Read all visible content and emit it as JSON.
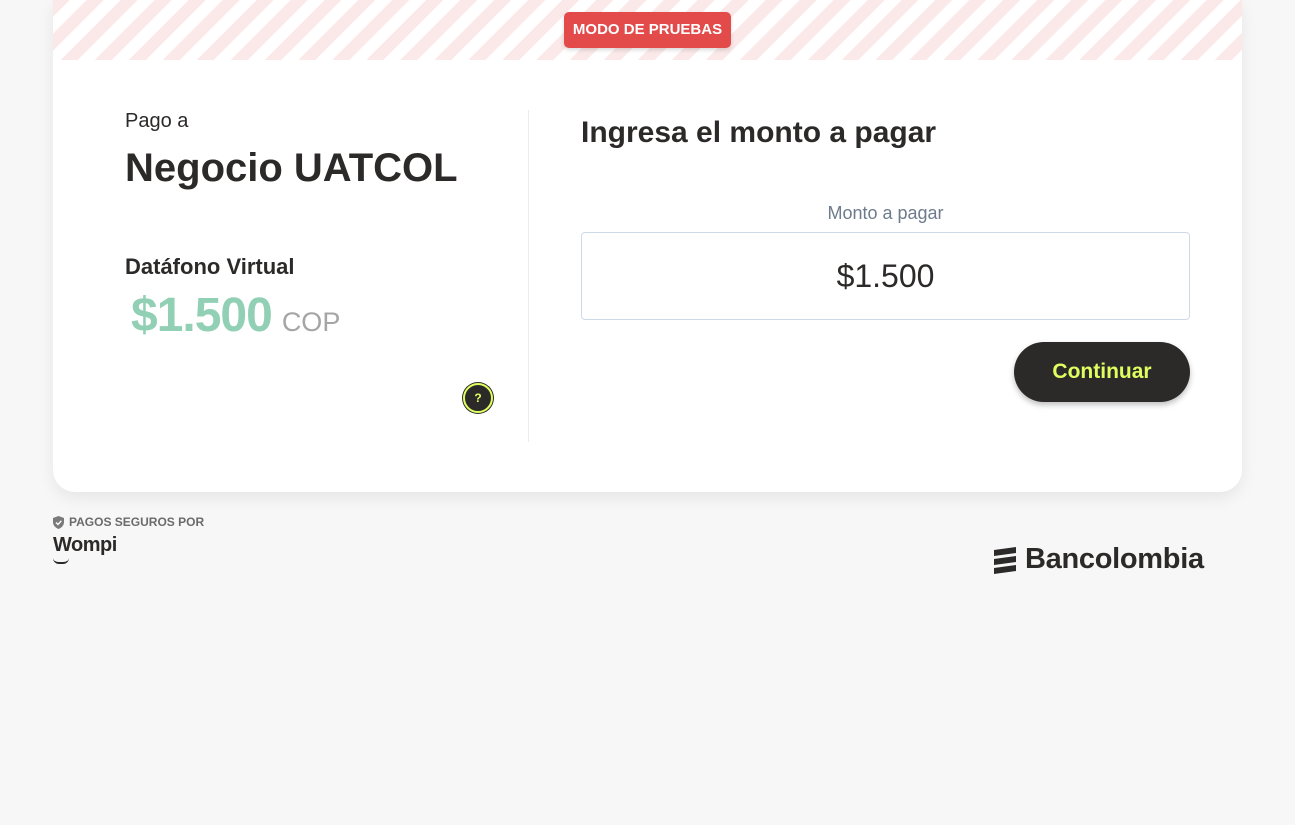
{
  "banner": {
    "test_mode_label": "MODO DE PRUEBAS"
  },
  "merchant": {
    "pay_to_label": "Pago a",
    "name": "Negocio UATCOL",
    "product_name": "Datáfono Virtual",
    "amount": "$1.500",
    "currency": "COP",
    "help_label": "?"
  },
  "payment_form": {
    "title": "Ingresa el monto a pagar",
    "field_label": "Monto a pagar",
    "amount_value": "$1.500",
    "continue_label": "Continuar"
  },
  "footer": {
    "secure_label": "PAGOS SEGUROS POR",
    "wompi_logo_text": "Wompi",
    "bancolombia_logo_text": "Bancolombia"
  },
  "icons": {
    "shield": "shield-check-icon",
    "help": "question-circle-icon",
    "bancolombia": "bancolombia-stripes-icon"
  },
  "colors": {
    "accent_lime": "#dfff61",
    "dark": "#2c2a29",
    "test_red": "#e34a4a",
    "amount_green": "#92d0b6"
  }
}
